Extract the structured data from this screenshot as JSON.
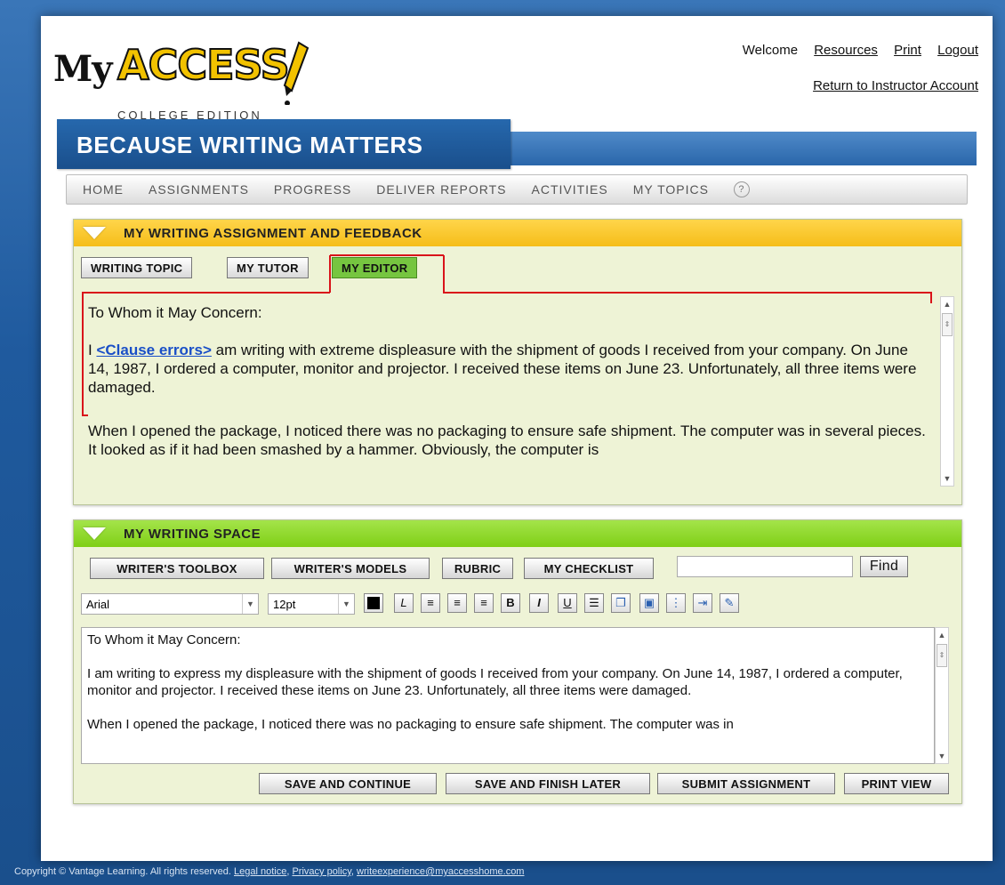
{
  "header": {
    "logo_my": "My",
    "logo_access": "ACCESS",
    "logo_edition": "COLLEGE EDITION",
    "welcome": "Welcome",
    "links": [
      "Resources",
      "Print",
      "Logout"
    ],
    "return_link": "Return to Instructor Account",
    "banner": "BECAUSE WRITING MATTERS"
  },
  "nav": {
    "items": [
      "HOME",
      "ASSIGNMENTS",
      "PROGRESS",
      "DELIVER REPORTS",
      "ACTIVITIES",
      "MY TOPICS"
    ],
    "help": "?"
  },
  "feedback_panel": {
    "title": "MY WRITING ASSIGNMENT AND FEEDBACK",
    "tabs": [
      "WRITING TOPIC",
      "MY TUTOR",
      "MY EDITOR"
    ],
    "active_tab": "MY EDITOR",
    "salutation": "To Whom it May Concern:",
    "para1_start": "I ",
    "clause_label": "<Clause errors>",
    "para1_rest": " am writing with extreme displeasure with the shipment of goods I received from your company.  On June 14, 1987, I ordered a computer, monitor and projector.  I received these items on June 23.  Unfortunately, all three items were damaged.",
    "para2": "When I opened the package, I noticed there was no packaging to ensure safe shipment.  The computer was in several pieces.  It looked as if it had been smashed by a hammer.  Obviously, the computer is"
  },
  "writing_space": {
    "title": "MY WRITING SPACE",
    "tool_buttons": [
      "WRITER'S TOOLBOX",
      "WRITER'S MODELS",
      "RUBRIC",
      "MY CHECKLIST"
    ],
    "find_value": "",
    "find_label": "Find",
    "font": "Arial",
    "size": "12pt",
    "toolbar_icons": [
      "color-swatch",
      "clear-format",
      "align-left",
      "align-center",
      "align-right",
      "bold",
      "italic",
      "underline",
      "bullet-list",
      "copy",
      "paste",
      "numbered-list",
      "indent",
      "spellcheck"
    ],
    "editor_salutation": "To Whom it May Concern:",
    "editor_para1": "I am writing to express my displeasure with the shipment of goods I received from your company.  On June 14, 1987, I ordered a computer, monitor and projector.  I received these items on June 23.  Unfortunately, all three items were damaged.",
    "editor_para2": "When I opened the package, I noticed there was no packaging to ensure safe shipment.  The computer was in",
    "action_buttons": [
      "SAVE AND CONTINUE",
      "SAVE AND FINISH LATER",
      "SUBMIT ASSIGNMENT",
      "PRINT VIEW"
    ]
  },
  "footer": {
    "copyright": "Copyright © Vantage Learning. All rights reserved.",
    "links": [
      "Legal notice",
      "Privacy policy",
      "writeexperience@myaccesshome.com"
    ]
  },
  "colors": {
    "page_bg": "#1f5a9e",
    "panel_bg": "#eef3d6",
    "feedback_header": "#f5bd19",
    "writing_header": "#7fcf16",
    "active_tab": "#76c540",
    "highlight_border": "#d9131a",
    "clause_link": "#1a4fc7"
  }
}
